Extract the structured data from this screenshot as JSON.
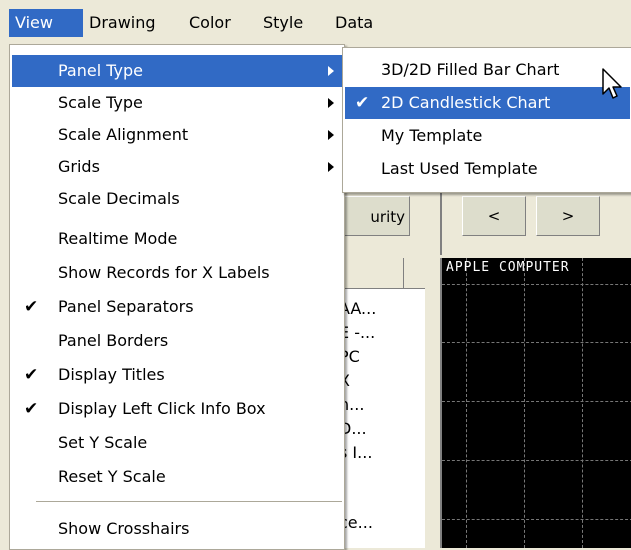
{
  "menubar": {
    "items": [
      "View",
      "Drawing",
      "Color",
      "Style",
      "Data"
    ]
  },
  "view_menu": {
    "items": [
      {
        "label": "Panel Type",
        "checked": false,
        "submenu": true,
        "highlighted": true
      },
      {
        "label": "Scale Type",
        "checked": false,
        "submenu": true
      },
      {
        "label": "Scale Alignment",
        "checked": false,
        "submenu": true
      },
      {
        "label": "Grids",
        "checked": false,
        "submenu": true
      },
      {
        "label": "Scale Decimals",
        "checked": false,
        "submenu": false
      },
      {
        "label": "Realtime Mode",
        "checked": false,
        "submenu": false
      },
      {
        "label": "Show Records for X Labels",
        "checked": false,
        "submenu": false
      },
      {
        "label": "Panel Separators",
        "checked": true,
        "submenu": false
      },
      {
        "label": "Panel Borders",
        "checked": false,
        "submenu": false
      },
      {
        "label": "Display Titles",
        "checked": true,
        "submenu": false
      },
      {
        "label": "Display Left Click Info Box",
        "checked": true,
        "submenu": false
      },
      {
        "label": "Set Y Scale",
        "checked": false,
        "submenu": false
      },
      {
        "label": "Reset Y Scale",
        "checked": false,
        "submenu": false
      },
      {
        "label": "Show Crosshairs",
        "checked": false,
        "submenu": false
      }
    ]
  },
  "panel_type_submenu": {
    "items": [
      {
        "label": "3D/2D Filled Bar Chart",
        "checked": false
      },
      {
        "label": "2D Candlestick Chart",
        "checked": true,
        "highlighted": true
      },
      {
        "label": "My Template",
        "checked": false
      },
      {
        "label": "Last Used Template",
        "checked": false
      }
    ]
  },
  "background": {
    "security_button": "urity",
    "nav_prev": "<",
    "nav_next": ">",
    "list_rows": [
      "AA...",
      "E -...",
      "PC",
      "X",
      "n...",
      "D...",
      "s I...",
      "",
      "ce..."
    ],
    "chart_title": "APPLE COMPUTER"
  },
  "glyphs": {
    "check": "✔"
  },
  "colors": {
    "highlight": "#316ac5",
    "chart_bg": "#000000"
  }
}
